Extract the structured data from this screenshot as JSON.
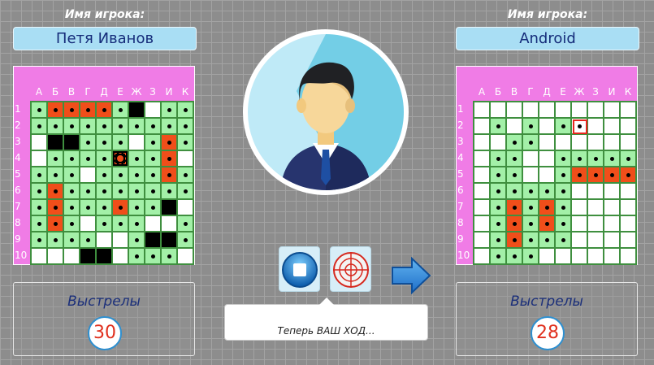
{
  "colors": {
    "hit": "#f04e1a",
    "miss": "#a3f0a8",
    "ship": "#000000",
    "board": "#f07ce6",
    "name_box": "#a9def4"
  },
  "columns": [
    "А",
    "Б",
    "В",
    "Г",
    "Д",
    "Е",
    "Ж",
    "З",
    "И",
    "К"
  ],
  "rows": [
    "1",
    "2",
    "3",
    "4",
    "5",
    "6",
    "7",
    "8",
    "9",
    "10"
  ],
  "cell_legend": {
    "e": "empty",
    "m": "miss",
    "h": "hit",
    "s": "ship",
    "x": "incoming shot",
    "t": "target cursor"
  },
  "left_player": {
    "caption": "Имя игрока:",
    "name": "Петя Иванов",
    "shots_label": "Выстрелы",
    "shots": "30",
    "board": [
      "mhhhhmsemm",
      "mmmmmmmmmm",
      "essmmmemhm",
      "emmmmxmmhe",
      "mmmemmmmhm",
      "mhmmmmmmmm",
      "mhmmmhmmse",
      "mhmemmmeem",
      "mmmmeemssm",
      "eeessemmme"
    ]
  },
  "right_player": {
    "caption": "Имя игрока:",
    "name": "Android",
    "shots_label": "Выстрелы",
    "shots": "28",
    "board": [
      "eeeeeeeeee",
      "emememteee",
      "eemmeeeeee",
      "emmeemmmmm",
      "emmeemhhhh",
      "emmmmmeeee",
      "emhmhmeeee",
      "emhmhmeeee",
      "emhmmmeeee",
      "emmmeeeeee"
    ]
  },
  "status_message": "Теперь ВАШ ХОД...",
  "icons": {
    "avatar": "user-avatar-icon",
    "stop": "stop-icon",
    "target": "crosshair-icon",
    "arrow": "arrow-right-icon"
  }
}
